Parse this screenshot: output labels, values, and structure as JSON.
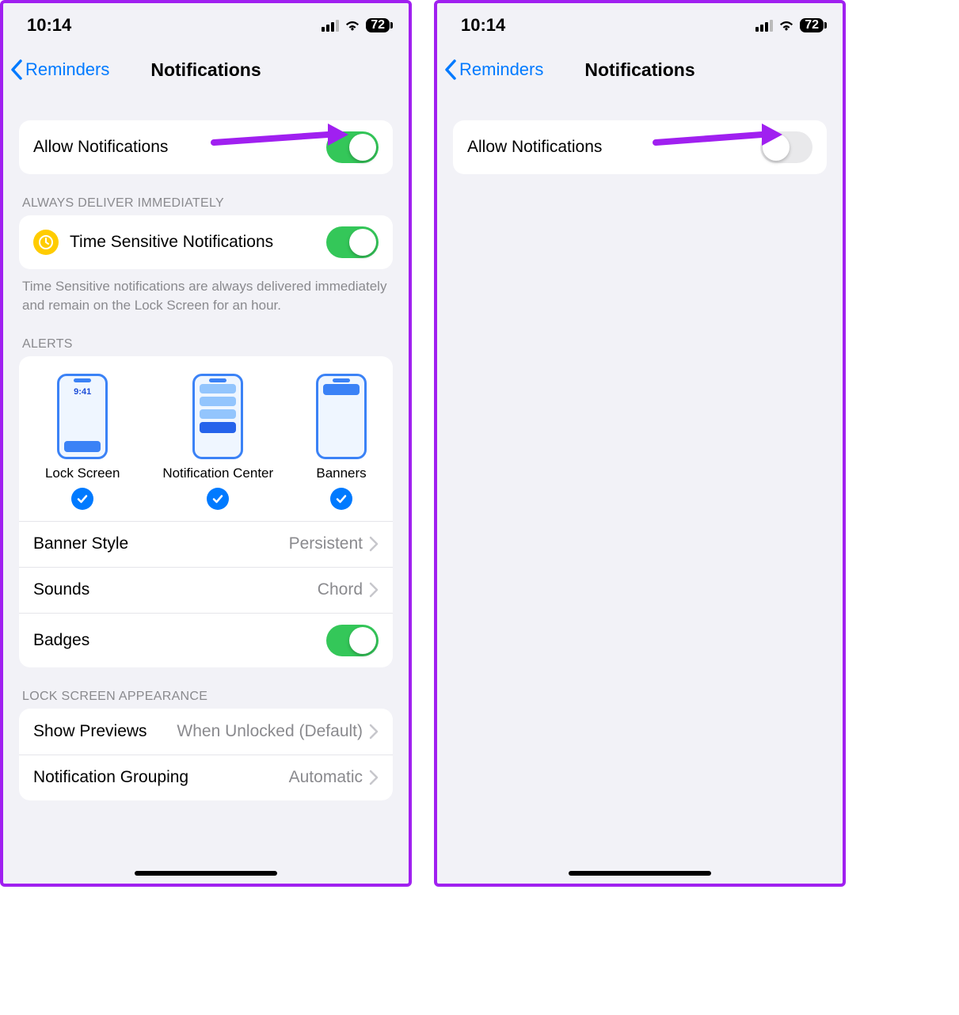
{
  "status": {
    "time": "10:14",
    "battery": "72"
  },
  "nav": {
    "back": "Reminders",
    "title": "Notifications"
  },
  "left": {
    "allow_label": "Allow Notifications",
    "section_always": "ALWAYS DELIVER IMMEDIATELY",
    "ts_label": "Time Sensitive Notifications",
    "ts_footer": "Time Sensitive notifications are always delivered immediately and remain on the Lock Screen for an hour.",
    "section_alerts": "ALERTS",
    "alerts": {
      "lock": "Lock Screen",
      "center": "Notification Center",
      "banners": "Banners",
      "mini_time": "9:41"
    },
    "banner_style": {
      "label": "Banner Style",
      "value": "Persistent"
    },
    "sounds": {
      "label": "Sounds",
      "value": "Chord"
    },
    "badges_label": "Badges",
    "section_lock": "LOCK SCREEN APPEARANCE",
    "previews": {
      "label": "Show Previews",
      "value": "When Unlocked (Default)"
    },
    "grouping": {
      "label": "Notification Grouping",
      "value": "Automatic"
    }
  },
  "right": {
    "allow_label": "Allow Notifications"
  }
}
